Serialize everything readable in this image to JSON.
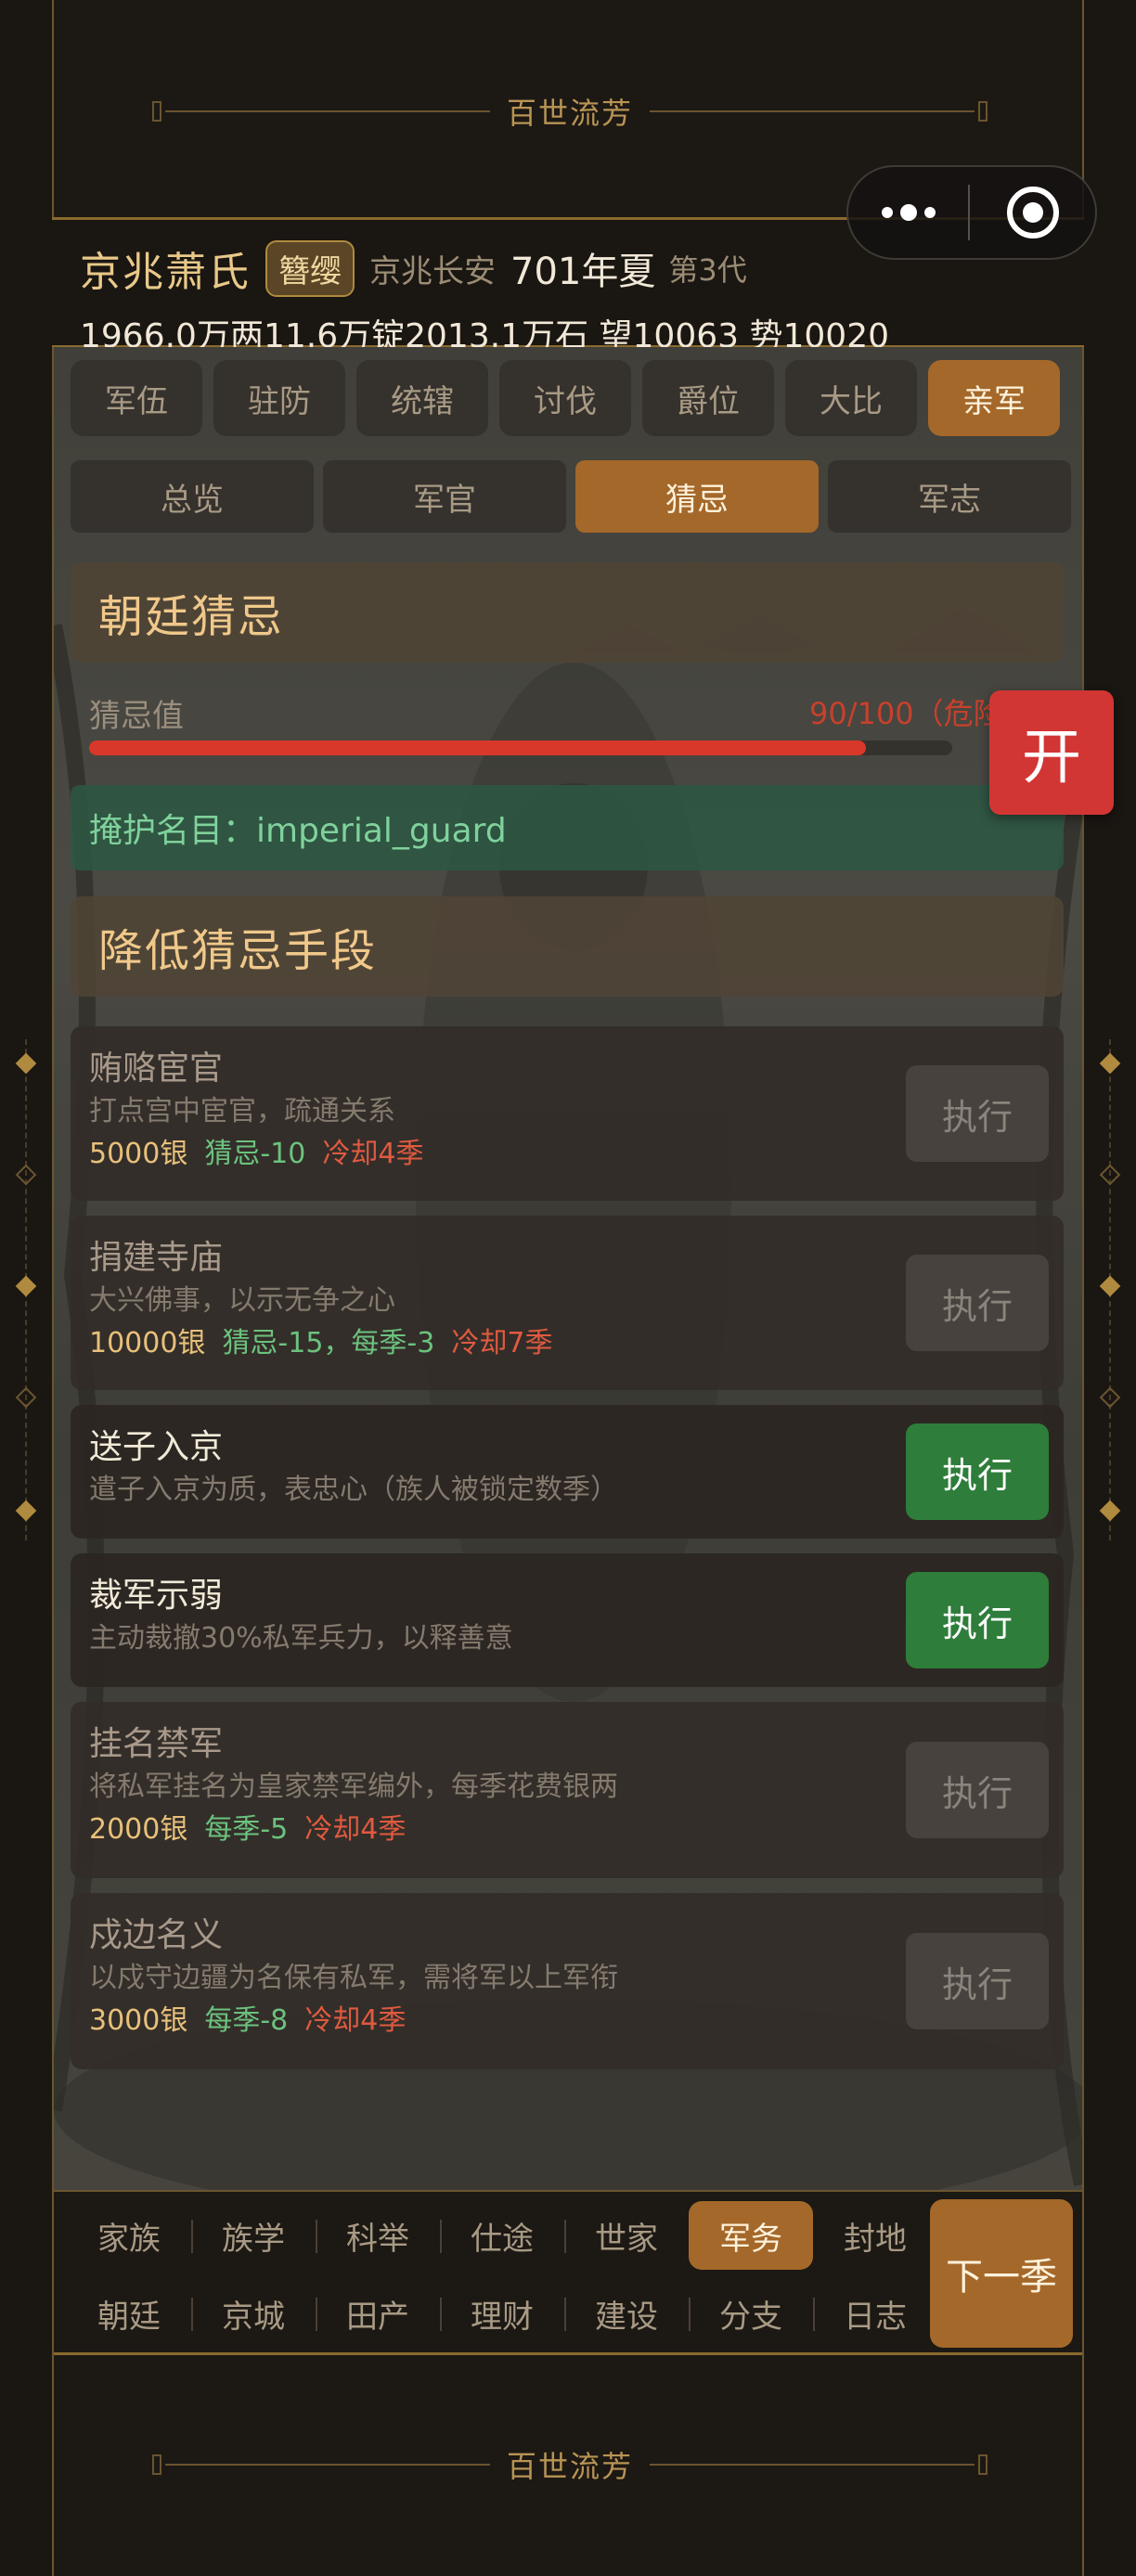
{
  "app": {
    "title": "百世流芳",
    "footer_title": "百世流芳"
  },
  "capsule": {
    "more": "more-dots-icon",
    "close": "target-circle-icon"
  },
  "header": {
    "clan": "京兆萧氏",
    "rank": "簪缨",
    "location": "京兆长安",
    "date": "701年夏",
    "generation": "第3代",
    "resources": "1966.0万两11.6万锭2013.1万石  望10063 势10020"
  },
  "tabs": [
    "军伍",
    "驻防",
    "统辖",
    "讨伐",
    "爵位",
    "大比",
    "亲军"
  ],
  "active_tab": "亲军",
  "subtabs": [
    "总览",
    "军官",
    "猜忌",
    "军志"
  ],
  "active_subtab": "猜忌",
  "suspicion": {
    "title": "朝廷猜忌",
    "label": "猜忌值",
    "value_text": "90/100（危险",
    "value": 90,
    "max": 100,
    "cover_text": "掩护名目：imperial_guard"
  },
  "reduce": {
    "title": "降低猜忌手段",
    "button_label": "执行",
    "actions": [
      {
        "name": "贿赂宦官",
        "desc": "打点宫中宦官，疏通关系",
        "cost": "5000银",
        "effect": "猜忌-10",
        "cooldown": "冷却4季",
        "enabled": false
      },
      {
        "name": "捐建寺庙",
        "desc": "大兴佛事，以示无争之心",
        "cost": "10000银",
        "effect": "猜忌-15，每季-3",
        "cooldown": "冷却7季",
        "enabled": false
      },
      {
        "name": "送子入京",
        "desc": "遣子入京为质，表忠心（族人被锁定数季）",
        "cost": "",
        "effect": "",
        "cooldown": "",
        "enabled": true
      },
      {
        "name": "裁军示弱",
        "desc": "主动裁撤30%私军兵力，以释善意",
        "cost": "",
        "effect": "",
        "cooldown": "",
        "enabled": true
      },
      {
        "name": "挂名禁军",
        "desc": "将私军挂名为皇家禁军编外，每季花费银两",
        "cost": "2000银",
        "effect": "每季-5",
        "cooldown": "冷却4季",
        "enabled": false
      },
      {
        "name": "戍边名义",
        "desc": "以戍守边疆为名保有私军，需将军以上军衔",
        "cost": "3000银",
        "effect": "每季-8",
        "cooldown": "冷却4季",
        "enabled": false
      }
    ]
  },
  "float_button": "开",
  "bottom_nav": {
    "row1": [
      "家族",
      "族学",
      "科举",
      "仕途",
      "世家",
      "军务",
      "封地"
    ],
    "row2": [
      "朝廷",
      "京城",
      "田产",
      "理财",
      "建设",
      "分支",
      "日志"
    ],
    "active": "军务",
    "next": "下一季"
  },
  "colors": {
    "accent": "#a4682a",
    "gold": "#e9c98a",
    "danger": "#d8382a",
    "success": "#2e7d3a",
    "cover_green": "#7fd29c"
  }
}
